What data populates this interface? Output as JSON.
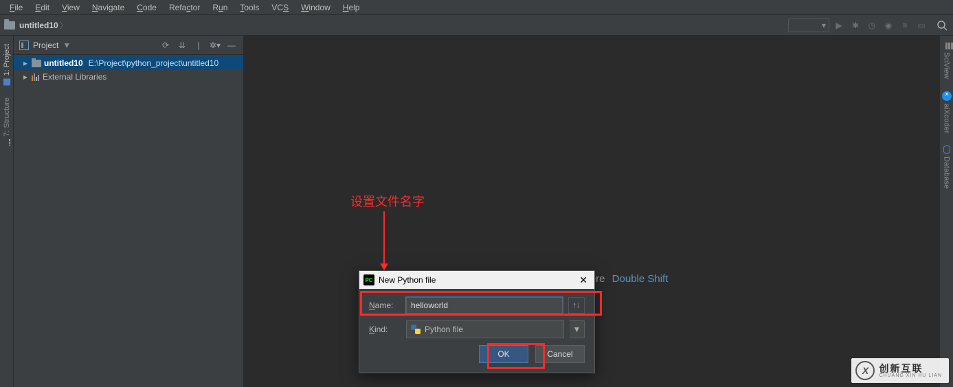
{
  "menu": {
    "items": [
      "File",
      "Edit",
      "View",
      "Navigate",
      "Code",
      "Refactor",
      "Run",
      "Tools",
      "VCS",
      "Window",
      "Help"
    ],
    "underline_index": [
      0,
      0,
      0,
      0,
      0,
      4,
      1,
      0,
      2,
      0,
      0
    ]
  },
  "breadcrumb": {
    "project": "untitled10"
  },
  "toolbar_icons": [
    "run-icon",
    "debug-icon",
    "coverage-icon",
    "profile-icon",
    "stack-icon",
    "layout-icon"
  ],
  "left_tabs": [
    {
      "id": "project",
      "label": "1: Project"
    },
    {
      "id": "structure",
      "label": "7: Structure"
    }
  ],
  "right_tabs": [
    {
      "id": "sciview",
      "label": "SciView"
    },
    {
      "id": "aixcoder",
      "label": "aiXcoder"
    },
    {
      "id": "database",
      "label": "Database"
    }
  ],
  "project_panel": {
    "title": "Project",
    "header_buttons": [
      "sync-icon",
      "collapse-icon",
      "gear-icon",
      "hide-icon"
    ],
    "tree": [
      {
        "type": "folder",
        "name": "untitled10",
        "path": "E:\\Project\\python_project\\untitled10",
        "selected": true,
        "expandable": true
      },
      {
        "type": "lib",
        "name": "External Libraries",
        "expandable": true
      }
    ]
  },
  "editor_hint": {
    "text": "Search Everywhere",
    "shortcut": "Double Shift"
  },
  "dialog": {
    "title": "New Python file",
    "name_label": "Name:",
    "name_value": "helloworld",
    "kind_label": "Kind:",
    "kind_value": "Python file",
    "ok": "OK",
    "cancel": "Cancel"
  },
  "annotation": {
    "text": "设置文件名字"
  },
  "watermark": {
    "cn": "创新互联",
    "en": "CHUANG XIN HU LIAN",
    "logo": "X"
  }
}
